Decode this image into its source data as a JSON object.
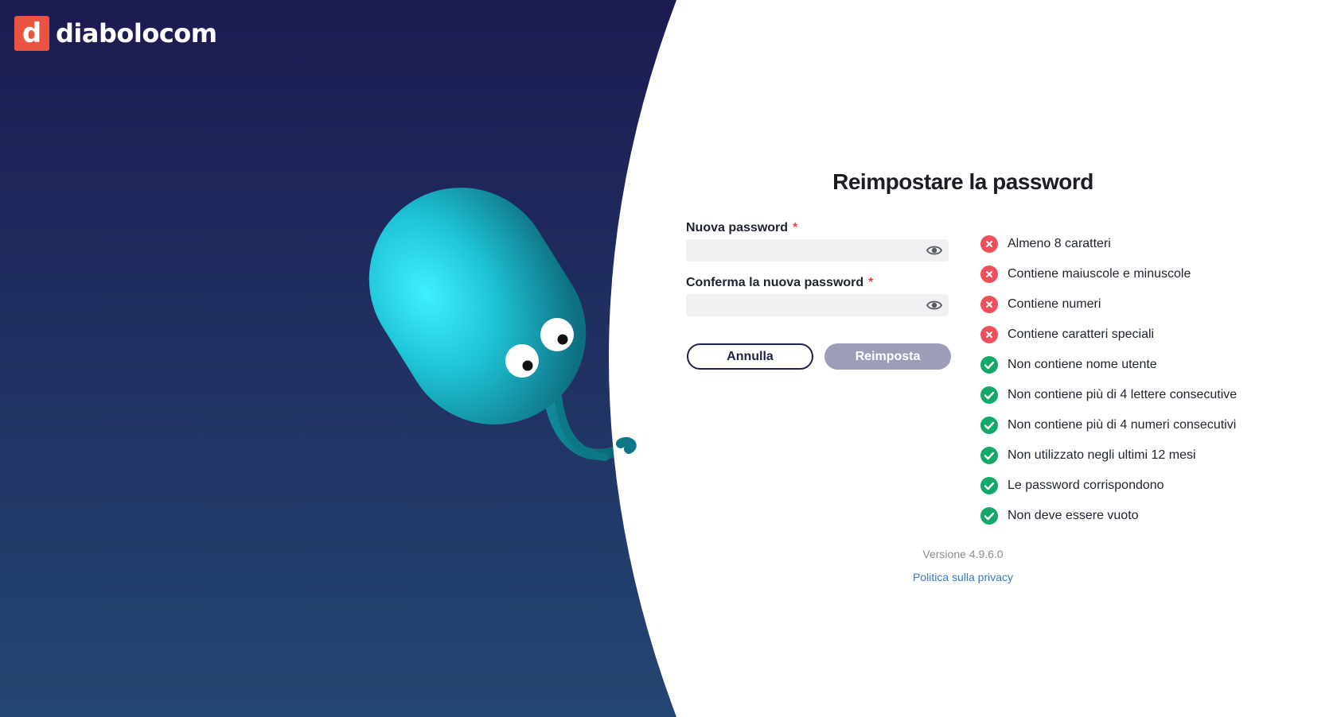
{
  "brand": {
    "logo_letter": "d",
    "name": "diabolocom",
    "accent": "#e9533f"
  },
  "form": {
    "title": "Reimpostare la password",
    "new_password": {
      "label": "Nuova password",
      "required_mark": "*",
      "value": "",
      "toggle_icon": "eye-icon"
    },
    "confirm_password": {
      "label": "Conferma la nuova password",
      "required_mark": "*",
      "value": "",
      "toggle_icon": "eye-icon"
    },
    "cancel_label": "Annulla",
    "submit_label": "Reimposta"
  },
  "rules": [
    {
      "text": "Almeno 8 caratteri",
      "status": "fail"
    },
    {
      "text": "Contiene maiuscole e minuscole",
      "status": "fail"
    },
    {
      "text": "Contiene numeri",
      "status": "fail"
    },
    {
      "text": "Contiene caratteri speciali",
      "status": "fail"
    },
    {
      "text": "Non contiene nome utente",
      "status": "pass"
    },
    {
      "text": "Non contiene più di 4 lettere consecutive",
      "status": "pass"
    },
    {
      "text": "Non contiene più di 4 numeri consecutivi",
      "status": "pass"
    },
    {
      "text": "Non utilizzato negli ultimi 12 mesi",
      "status": "pass"
    },
    {
      "text": "Le password corrispondono",
      "status": "pass"
    },
    {
      "text": "Non deve essere vuoto",
      "status": "pass"
    }
  ],
  "status_colors": {
    "fail": "#ef4f5a",
    "pass": "#14a86b"
  },
  "footer": {
    "version": "Versione 4.9.6.0",
    "privacy_link": "Politica sulla privacy"
  }
}
